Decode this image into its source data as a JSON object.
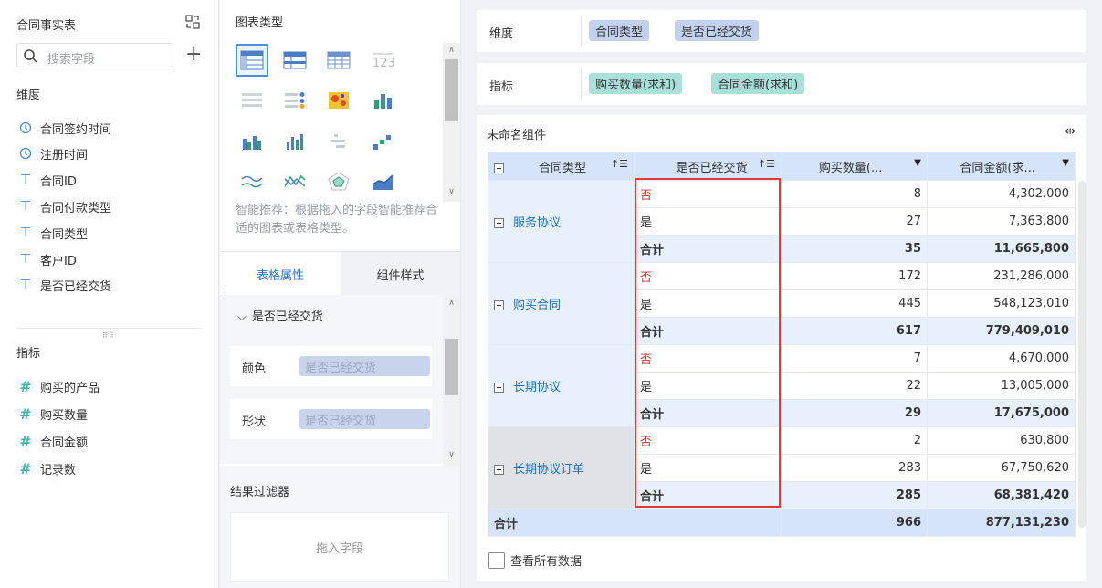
{
  "left": {
    "title": "合同事实表",
    "search_placeholder": "搜索字段",
    "dimensions_label": "维度",
    "dimensions": [
      {
        "label": "合同签约时间",
        "icon": "clock-icon"
      },
      {
        "label": "注册时间",
        "icon": "clock-icon"
      },
      {
        "label": "合同ID",
        "icon": "text-field-icon"
      },
      {
        "label": "合同付款类型",
        "icon": "text-field-icon"
      },
      {
        "label": "合同类型",
        "icon": "text-field-icon"
      },
      {
        "label": "客户ID",
        "icon": "text-field-icon"
      },
      {
        "label": "是否已经交货",
        "icon": "text-field-icon"
      }
    ],
    "measures_label": "指标",
    "measures": [
      {
        "label": "购买的产品",
        "icon": "hash-icon"
      },
      {
        "label": "购买数量",
        "icon": "hash-icon"
      },
      {
        "label": "合同金额",
        "icon": "hash-icon"
      },
      {
        "label": "记录数",
        "icon": "hash-icon"
      }
    ]
  },
  "mid": {
    "chart_types_title": "图表类型",
    "hint": "智能推荐：根据拖入的字段智能推荐合适的图表或表格类型。",
    "tab_table_props": "表格属性",
    "tab_component_style": "组件样式",
    "prop_group": "是否已经交货",
    "color_label": "颜色",
    "color_value": "是否已经交货",
    "shape_label": "形状",
    "shape_value": "是否已经交货",
    "filter_title": "结果过滤器",
    "drop_text": "拖入字段"
  },
  "right": {
    "dimension_label": "维度",
    "dimension_chips": [
      "合同类型",
      "是否已经交货"
    ],
    "measure_label": "指标",
    "measure_chips": [
      "购买数量(求和)",
      "合同金额(求和)"
    ],
    "component_title": "未命名组件",
    "headers": [
      "合同类型",
      "是否已经交货",
      "购买数量(...",
      "合同金额(求..."
    ],
    "groups": [
      {
        "name": "服务协议",
        "rows": [
          [
            "否",
            "8",
            "4,302,000"
          ],
          [
            "是",
            "27",
            "7,363,800"
          ]
        ],
        "subtotal": [
          "合计",
          "35",
          "11,665,800"
        ]
      },
      {
        "name": "购买合同",
        "rows": [
          [
            "否",
            "172",
            "231,286,000"
          ],
          [
            "是",
            "445",
            "548,123,010"
          ]
        ],
        "subtotal": [
          "合计",
          "617",
          "779,409,010"
        ]
      },
      {
        "name": "长期协议",
        "rows": [
          [
            "否",
            "7",
            "4,670,000"
          ],
          [
            "是",
            "22",
            "13,005,000"
          ]
        ],
        "subtotal": [
          "合计",
          "29",
          "17,675,000"
        ]
      },
      {
        "name": "长期协议订单",
        "rows": [
          [
            "否",
            "2",
            "630,800"
          ],
          [
            "是",
            "283",
            "67,750,620"
          ]
        ],
        "subtotal": [
          "合计",
          "285",
          "68,381,420"
        ]
      }
    ],
    "total": [
      "合计",
      "966",
      "877,131,230"
    ],
    "show_all_label": "查看所有数据"
  },
  "colors": {
    "accent": "#2a73d8",
    "negative": "#d9302d",
    "highlight": "#e23a3a"
  }
}
